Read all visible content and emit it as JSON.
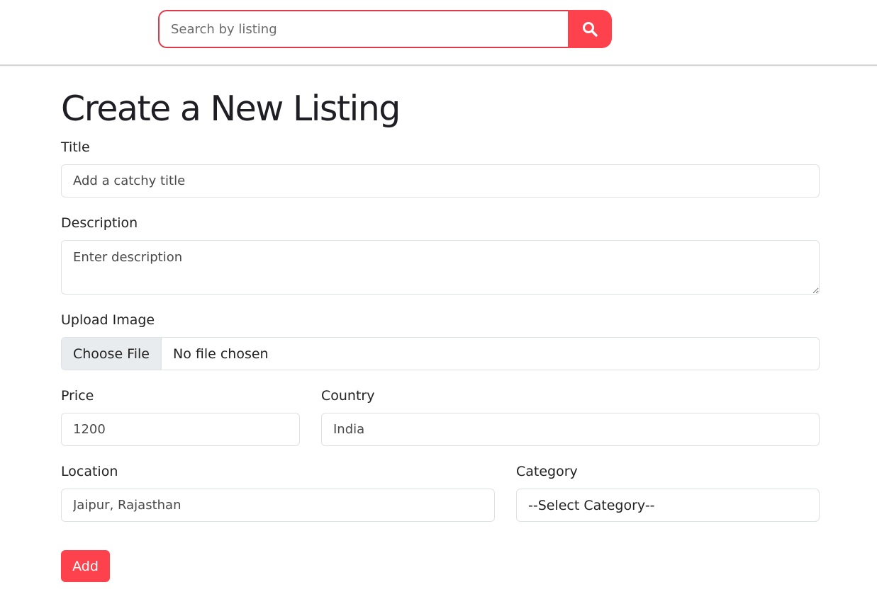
{
  "header": {
    "search": {
      "placeholder": "Search by listing",
      "button_icon": "search-icon"
    }
  },
  "page": {
    "title": "Create a New Listing"
  },
  "form": {
    "title": {
      "label": "Title",
      "placeholder": "Add a catchy title"
    },
    "description": {
      "label": "Description",
      "placeholder": "Enter description"
    },
    "image": {
      "label": "Upload Image",
      "button_label": "Choose File",
      "status": "No file chosen"
    },
    "price": {
      "label": "Price",
      "placeholder": "1200"
    },
    "country": {
      "label": "Country",
      "placeholder": "India"
    },
    "location": {
      "label": "Location",
      "placeholder": "Jaipur, Rajasthan"
    },
    "category": {
      "label": "Category",
      "selected": "--Select Category--"
    },
    "submit_label": "Add"
  },
  "colors": {
    "accent": "#fe424d",
    "search_border": "#e03a4a",
    "input_border": "#dee2e6",
    "file_button_bg": "#e9ecef"
  }
}
